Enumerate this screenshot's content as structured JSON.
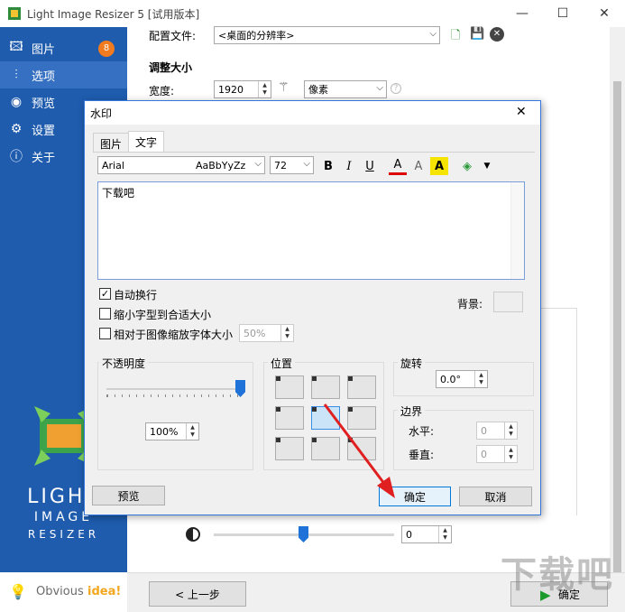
{
  "window": {
    "title": "Light Image Resizer 5  [试用版本]",
    "min": "—",
    "max": "☐",
    "close": "✕"
  },
  "sidebar": {
    "items": [
      {
        "label": "图片",
        "icon": "images-icon",
        "badge": "8"
      },
      {
        "label": "选项",
        "icon": "sliders-icon"
      },
      {
        "label": "预览",
        "icon": "eye-icon"
      },
      {
        "label": "设置",
        "icon": "gear-icon"
      },
      {
        "label": "关于",
        "icon": "info-icon"
      }
    ],
    "logo_lines": [
      "LIGHT",
      "IMAGE",
      "RESIZER"
    ],
    "brand_prefix": "Obvious",
    "brand_suffix": "idea!"
  },
  "main": {
    "profile_label": "配置文件:",
    "profile_value": "<桌面的分辨率>",
    "resize_heading": "调整大小",
    "width_label": "宽度:",
    "width_value": "1920",
    "unit_value": "像素",
    "brightness_value": "0",
    "back_button": "< 上一步",
    "ok_button": "确定"
  },
  "dialog": {
    "title": "水印",
    "close": "✕",
    "tabs": [
      "图片",
      "文字"
    ],
    "font_name": "Arial",
    "font_sample": "AaBbYyZz",
    "font_size": "72",
    "bold": "B",
    "italic": "I",
    "underline": "U",
    "text_content": "下载吧",
    "auto_wrap_label": "自动换行",
    "shrink_label": "缩小字型到合适大小",
    "relative_label": "相对于图像缩放字体大小",
    "relative_value": "50%",
    "background_label": "背景:",
    "opacity_title": "不透明度",
    "opacity_value": "100%",
    "position_title": "位置",
    "rotation_title": "旋转",
    "rotation_value": "0.0°",
    "border_title": "边界",
    "horizontal_label": "水平:",
    "horizontal_value": "0",
    "vertical_label": "垂直:",
    "vertical_value": "0",
    "preview_button": "预览",
    "ok_button": "确定",
    "cancel_button": "取消",
    "opacity_level": 1.0
  },
  "watermark_overlay": "下载吧",
  "colors": {
    "sidebar": "#1f5cae",
    "accent": "#3377dd",
    "badge": "#f27b1f",
    "arrow": "#e02020"
  }
}
